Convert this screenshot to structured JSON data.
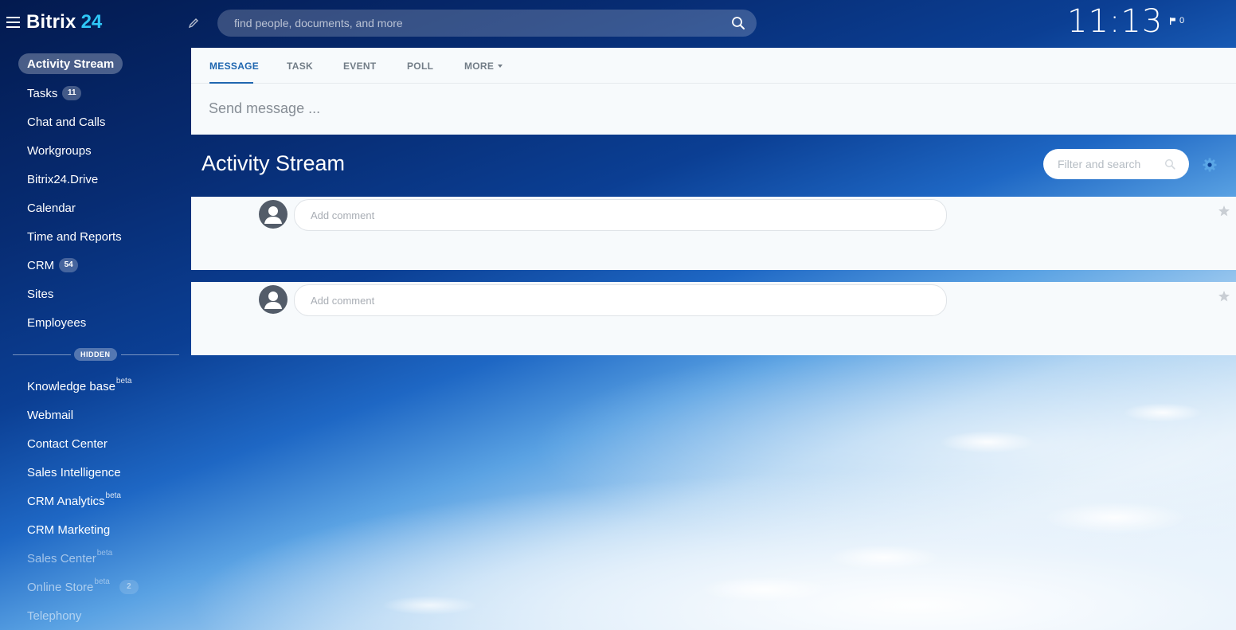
{
  "app": {
    "logo_name": "Bitrix",
    "logo_number": "24"
  },
  "header": {
    "search_placeholder": "find people, documents, and more",
    "clock": "11:13",
    "flag_count": "0"
  },
  "sidebar": {
    "active": "Activity Stream",
    "items": [
      {
        "label": "Activity Stream"
      },
      {
        "label": "Tasks",
        "counter": "11"
      },
      {
        "label": "Chat and Calls"
      },
      {
        "label": "Workgroups"
      },
      {
        "label": "Bitrix24.Drive"
      },
      {
        "label": "Calendar"
      },
      {
        "label": "Time and Reports"
      },
      {
        "label": "CRM",
        "counter": "54"
      },
      {
        "label": "Sites"
      },
      {
        "label": "Employees"
      }
    ],
    "hidden_label": "HIDDEN",
    "hidden_items": [
      {
        "label": "Knowledge base",
        "sup": "beta"
      },
      {
        "label": "Webmail"
      },
      {
        "label": "Contact Center"
      },
      {
        "label": "Sales Intelligence"
      },
      {
        "label": "CRM Analytics",
        "sup": "beta"
      },
      {
        "label": "CRM Marketing"
      },
      {
        "label": "Sales Center",
        "sup": "beta"
      },
      {
        "label": "Online Store",
        "sup": "beta",
        "counter": "2"
      },
      {
        "label": "Telephony"
      }
    ]
  },
  "composer": {
    "tabs": [
      "MESSAGE",
      "TASK",
      "EVENT",
      "POLL",
      "MORE"
    ],
    "active_tab": "MESSAGE",
    "send_placeholder": "Send message ..."
  },
  "stream": {
    "title": "Activity Stream",
    "filter_placeholder": "Filter and search",
    "posts": [
      {
        "comment_placeholder": "Add comment"
      },
      {
        "comment_placeholder": "Add comment"
      }
    ]
  },
  "colors": {
    "accent": "#2067b0",
    "logo_number": "#2fc6f6",
    "panel": "#f7fafc",
    "avatar": "#535c69"
  },
  "icons": [
    "menu-icon",
    "pencil-icon",
    "search-icon",
    "flag-icon",
    "gear-icon",
    "user-icon",
    "star-icon",
    "chevron-down-icon"
  ]
}
